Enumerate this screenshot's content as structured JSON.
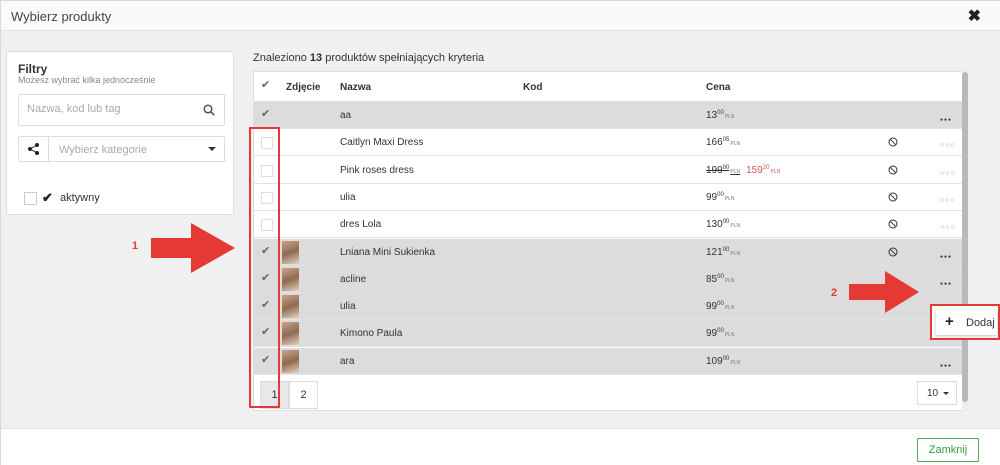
{
  "modal": {
    "title": "Wybierz produkty",
    "close_icon": "close-icon"
  },
  "filters": {
    "title": "Filtry",
    "subtitle": "Możesz wybrać kilka jednocześnie",
    "search_placeholder": "Nazwa, kod lub tag",
    "category_placeholder": "Wybierz kategorie",
    "active_label": "aktywny"
  },
  "results": {
    "prefix": "Znaleziono",
    "count": "13",
    "suffix": "produktów spełniających kryteria"
  },
  "table": {
    "headers": {
      "photo": "Zdjęcie",
      "name": "Nazwa",
      "code": "Kod",
      "price": "Cena"
    },
    "rows": [
      {
        "selected": true,
        "photo": false,
        "name": "aa",
        "price_int": "13",
        "price_dec": "00",
        "currency": "PLN",
        "disabled": false
      },
      {
        "selected": false,
        "photo": false,
        "name": "Caitlyn Maxi Dress",
        "price_int": "166",
        "price_dec": "05",
        "currency": "PLN",
        "disabled": true
      },
      {
        "selected": false,
        "photo": false,
        "name": "Pink roses dress",
        "price_int": "199",
        "price_dec": "00",
        "currency": "PLN",
        "sale_int": "159",
        "sale_dec": "20",
        "disabled": true
      },
      {
        "selected": false,
        "photo": false,
        "name": "ulia",
        "price_int": "99",
        "price_dec": "00",
        "currency": "PLN",
        "disabled": true
      },
      {
        "selected": false,
        "photo": false,
        "name": "dres Lola",
        "price_int": "130",
        "price_dec": "00",
        "currency": "PLN",
        "disabled": true
      },
      {
        "selected": true,
        "photo": true,
        "name": "Lniana Mini Sukienka",
        "price_int": "121",
        "price_dec": "00",
        "currency": "PLN",
        "disabled": true
      },
      {
        "selected": true,
        "photo": true,
        "name": "acline",
        "price_int": "85",
        "price_dec": "00",
        "currency": "PLN",
        "disabled": false
      },
      {
        "selected": true,
        "photo": true,
        "name": "ulia",
        "price_int": "99",
        "price_dec": "00",
        "currency": "PLN",
        "disabled": false
      },
      {
        "selected": true,
        "photo": true,
        "name": "Kimono Paula",
        "price_int": "99",
        "price_dec": "00",
        "currency": "PLN",
        "disabled": false
      },
      {
        "selected": true,
        "photo": true,
        "name": "ara",
        "price_int": "109",
        "price_dec": "00",
        "currency": "PLN",
        "disabled": false
      }
    ]
  },
  "pagination": {
    "pages": [
      "1",
      "2"
    ],
    "current": "1",
    "per_page": "10"
  },
  "context_menu": {
    "add_label": "Dodaj"
  },
  "annotations": {
    "label_1": "1",
    "label_2": "2",
    "color": "#e53935"
  },
  "footer": {
    "close_label": "Zamknij"
  }
}
